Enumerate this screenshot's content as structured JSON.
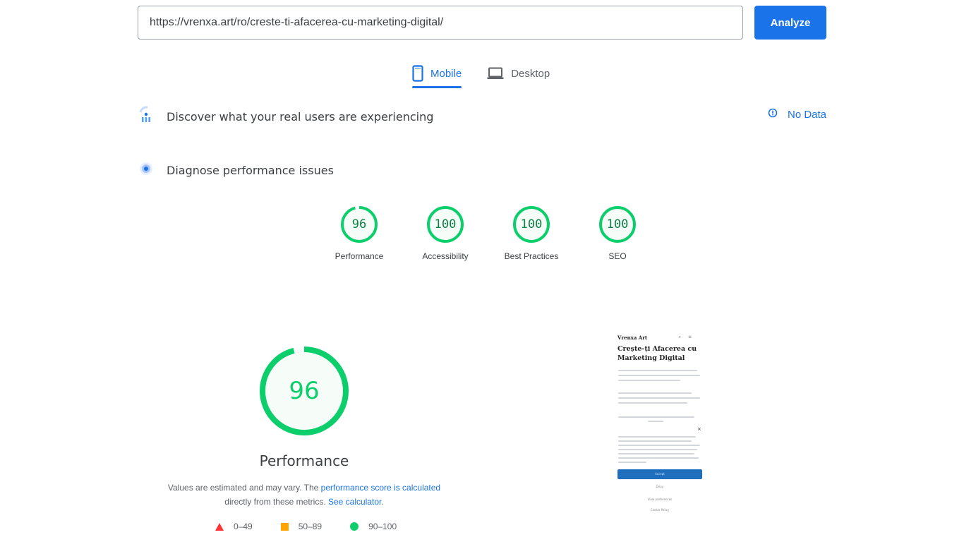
{
  "search": {
    "url_value": "https://vrenxa.art/ro/creste-ti-afacerea-cu-marketing-digital/",
    "analyze_label": "Analyze"
  },
  "tabs": [
    {
      "label": "Mobile",
      "icon": "smartphone-icon",
      "active": true
    },
    {
      "label": "Desktop",
      "icon": "laptop-icon",
      "active": false
    }
  ],
  "field_data": {
    "title": "Discover what your real users are experiencing",
    "icon": "crux-users-icon",
    "status_label": "No Data",
    "status_icon": "info-circle-icon"
  },
  "lab_data": {
    "title": "Diagnose performance issues",
    "icon": "lighthouse-icon"
  },
  "scores": [
    {
      "label": "Performance",
      "value": 96
    },
    {
      "label": "Accessibility",
      "value": 100
    },
    {
      "label": "Best Practices",
      "value": 100
    },
    {
      "label": "SEO",
      "value": 100
    }
  ],
  "performance": {
    "value": 96,
    "title": "Performance",
    "note_prefix": "Values are estimated and may vary. The ",
    "note_link1": "performance score is calculated",
    "note_middle": " directly from these metrics. ",
    "note_link2": "See calculator",
    "note_suffix": "."
  },
  "legend": [
    {
      "shape": "triangle",
      "range": "0–49",
      "color": "#ff3333"
    },
    {
      "shape": "square",
      "range": "50–89",
      "color": "#ffa400"
    },
    {
      "shape": "circle",
      "range": "90–100",
      "color": "#0cce6b"
    }
  ],
  "screenshot": {
    "brand": "Vrenxa Art",
    "heading": "Crește-ți Afacerea cu Marketing Digital",
    "close": "×",
    "accept_label": "Accept",
    "deny_label": "Deny",
    "prefs_label": "View preferences",
    "policy_label": "Cookie Policy"
  },
  "colors": {
    "accent": "#1a73e8",
    "pass": "#0cce6b",
    "average": "#ffa400",
    "fail": "#ff3333"
  }
}
